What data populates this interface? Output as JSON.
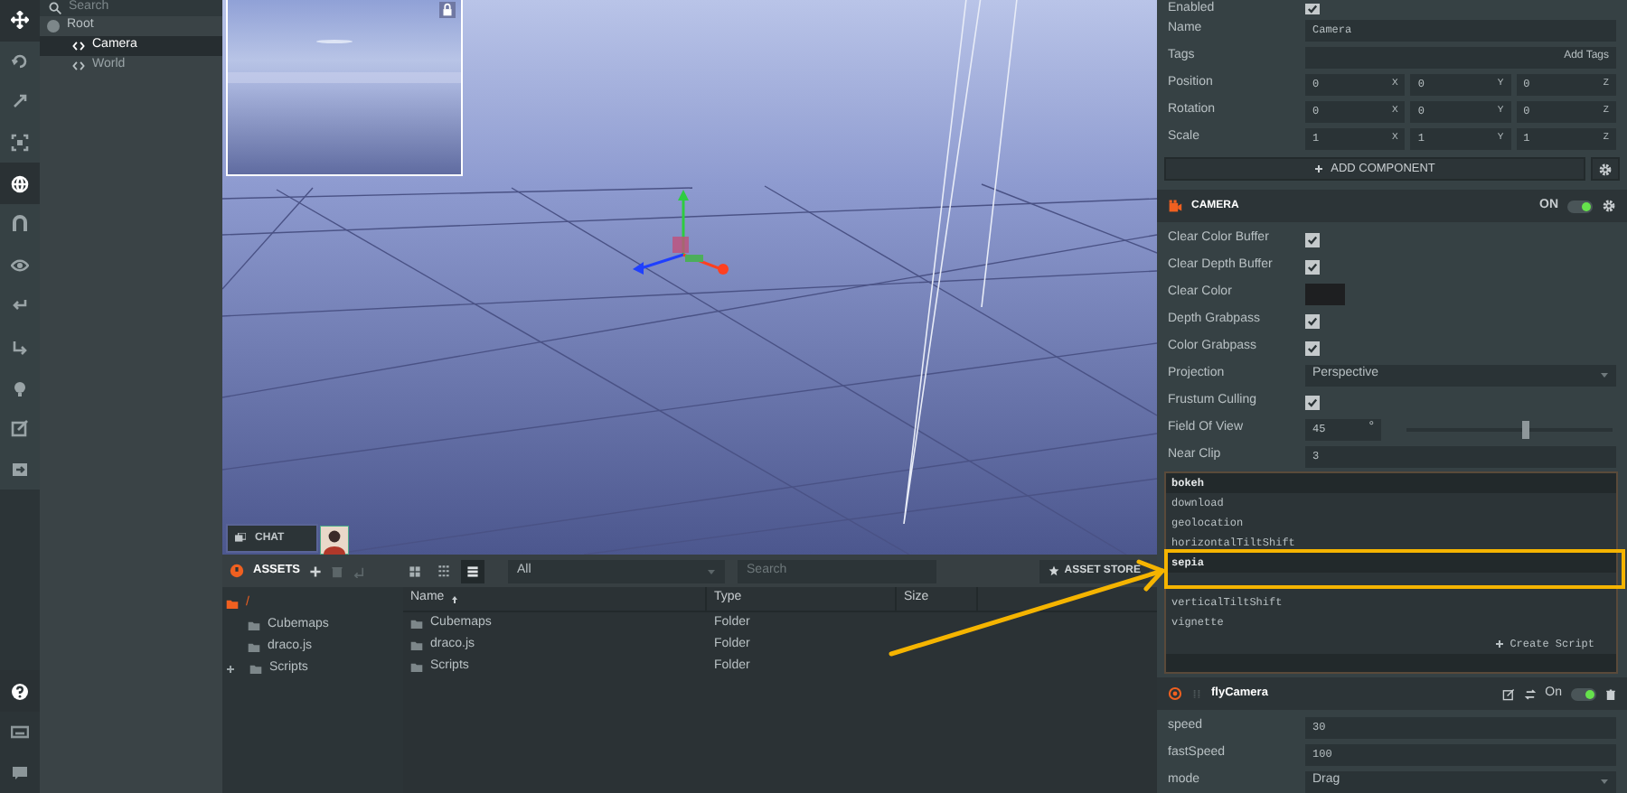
{
  "tools": [
    {
      "kind": "move",
      "selected": true
    },
    {
      "kind": "rotate",
      "selected": false
    },
    {
      "kind": "scale",
      "selected": false
    },
    {
      "kind": "resize",
      "selected": false
    },
    {
      "kind": "world",
      "selected": true
    },
    {
      "kind": "magnet",
      "selected": false
    },
    {
      "kind": "eye",
      "selected": false
    },
    {
      "kind": "undo",
      "selected": false
    },
    {
      "kind": "redo",
      "selected": false
    },
    {
      "kind": "bulb",
      "selected": false
    },
    {
      "kind": "edit",
      "selected": false
    },
    {
      "kind": "launch",
      "selected": false
    }
  ],
  "bottom_tools": [
    {
      "kind": "help"
    },
    {
      "kind": "keyboard"
    },
    {
      "kind": "chat"
    }
  ],
  "hierarchy": {
    "search_placeholder": "Search",
    "items": [
      {
        "label": "Root",
        "selected": false,
        "children": [
          {
            "label": "Camera",
            "selected": true
          },
          {
            "label": "World",
            "selected": false
          }
        ]
      }
    ]
  },
  "viewport": {
    "chat_label": "CHAT"
  },
  "assets": {
    "title": "ASSETS",
    "views": [
      {
        "kind": "small-grid",
        "selected": false
      },
      {
        "kind": "large-grid",
        "selected": false
      },
      {
        "kind": "details",
        "selected": true
      }
    ],
    "filter": "All",
    "search_placeholder": "Search",
    "store_label": "ASSET STORE",
    "tree": [
      {
        "label": "/",
        "collapsed": false,
        "children": [
          {
            "label": "Cubemaps",
            "collapsed": false
          },
          {
            "label": "draco.js",
            "collapsed": false
          },
          {
            "label": "Scripts",
            "collapsed": true
          }
        ]
      }
    ],
    "columns": [
      "Name",
      "Type",
      "Size"
    ],
    "rows": [
      {
        "name": "Cubemaps",
        "type": "Folder"
      },
      {
        "name": "draco.js",
        "type": "Folder"
      },
      {
        "name": "Scripts",
        "type": "Folder"
      }
    ]
  },
  "inspector": {
    "entity_rows": [
      {
        "label": "Enabled",
        "kind": "checkbox",
        "checked": true
      },
      {
        "label": "Name",
        "kind": "text",
        "value": "Camera"
      },
      {
        "label": "Tags",
        "kind": "tags",
        "value": "Add Tags"
      },
      {
        "label": "Position",
        "kind": "vector",
        "values": [
          "0",
          "0",
          "0"
        ],
        "axes": [
          "X",
          "Y",
          "Z"
        ]
      },
      {
        "label": "Rotation",
        "kind": "vector",
        "values": [
          "0",
          "0",
          "0"
        ],
        "axes": [
          "X",
          "Y",
          "Z"
        ]
      },
      {
        "label": "Scale",
        "kind": "vector",
        "values": [
          "1",
          "1",
          "1"
        ],
        "axes": [
          "X",
          "Y",
          "Z"
        ]
      }
    ],
    "add_component": "ADD COMPONENT",
    "camera": {
      "title": "CAMERA",
      "on_label": "ON",
      "on": true,
      "rows": [
        {
          "label": "Clear Color Buffer",
          "kind": "checkbox",
          "checked": true
        },
        {
          "label": "Clear Depth Buffer",
          "kind": "checkbox",
          "checked": true
        },
        {
          "label": "Clear Color",
          "kind": "color",
          "color": "#1e1f21"
        },
        {
          "label": "Depth Grabpass",
          "kind": "checkbox",
          "checked": true
        },
        {
          "label": "Color Grabpass",
          "kind": "checkbox",
          "checked": true
        },
        {
          "label": "Projection",
          "kind": "select",
          "value": "Perspective"
        },
        {
          "label": "Frustum Culling",
          "kind": "checkbox",
          "checked": true
        },
        {
          "label": "Field Of View",
          "kind": "slider",
          "value": "45",
          "unit": "°",
          "level": 0.58
        },
        {
          "label": "Near Clip",
          "kind": "text",
          "value": "3"
        }
      ]
    },
    "script_picker": {
      "items": [
        {
          "label": "bokeh",
          "selected": true
        },
        {
          "label": "download",
          "selected": false
        },
        {
          "label": "geolocation",
          "selected": false
        },
        {
          "label": "horizontalTiltShift",
          "selected": false
        },
        {
          "label": "sepia",
          "selected": true
        },
        {
          "label": "verticalTiltShift",
          "selected": false
        },
        {
          "label": "vignette",
          "selected": false
        }
      ],
      "create_label": "Create Script"
    },
    "script": {
      "title": "flyCamera",
      "on_label": "On",
      "on": true,
      "rows": [
        {
          "label": "speed",
          "kind": "text",
          "value": "30"
        },
        {
          "label": "fastSpeed",
          "kind": "text",
          "value": "100"
        },
        {
          "label": "mode",
          "kind": "select",
          "value": "Drag"
        }
      ]
    }
  }
}
